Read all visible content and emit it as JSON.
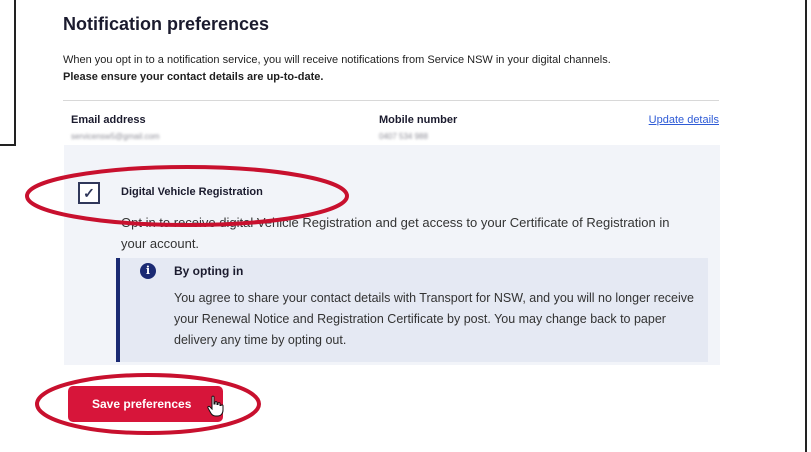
{
  "page": {
    "title": "Notification preferences",
    "intro_text": "When you opt in to a notification service, you will receive notifications from Service NSW in your digital channels.",
    "intro_bold": "Please ensure your contact details are up-to-date."
  },
  "contact": {
    "email_label": "Email address",
    "email_value": "servicensw5@gmail.com",
    "mobile_label": "Mobile number",
    "mobile_value": "0407 534 988",
    "update_link": "Update details"
  },
  "option": {
    "checked_mark": "✓",
    "label": "Digital Vehicle Registration",
    "description": "Opt in to receive digital Vehicle Registration and get access to your Certificate of Registration in your account."
  },
  "info": {
    "icon_glyph": "i",
    "title": "By opting in",
    "text": "You agree to share your contact details with Transport for NSW, and you will no longer receive your Renewal Notice and Registration Certificate by post. You may change back to paper delivery any time by opting out."
  },
  "actions": {
    "save_label": "Save preferences"
  },
  "colors": {
    "accent": "#d7153a",
    "navy": "#1b2a73",
    "link": "#2e5bd6",
    "annotation": "#c8102e"
  }
}
